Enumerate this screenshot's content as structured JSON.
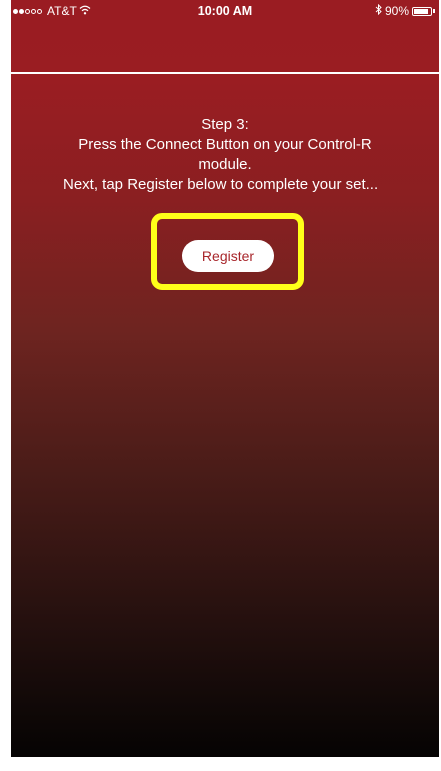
{
  "status_bar": {
    "carrier": "AT&T",
    "time": "10:00 AM",
    "battery_text": "90%",
    "battery_level": 0.9,
    "signal_bars_filled": 2,
    "signal_bars_total": 5,
    "wifi_icon": "wifi-icon",
    "bluetooth_icon": "bluetooth-icon"
  },
  "instructions": {
    "step": "Step 3:",
    "line1": "Press the Connect Button on your Control-R",
    "line2": "module.",
    "line3": "Next, tap Register below to complete your set..."
  },
  "register_button": {
    "label": "Register"
  },
  "colors": {
    "background_top": "#9a1c22",
    "background_bottom": "#050303",
    "highlight": "#ffff19",
    "button_text": "#a8262b"
  }
}
